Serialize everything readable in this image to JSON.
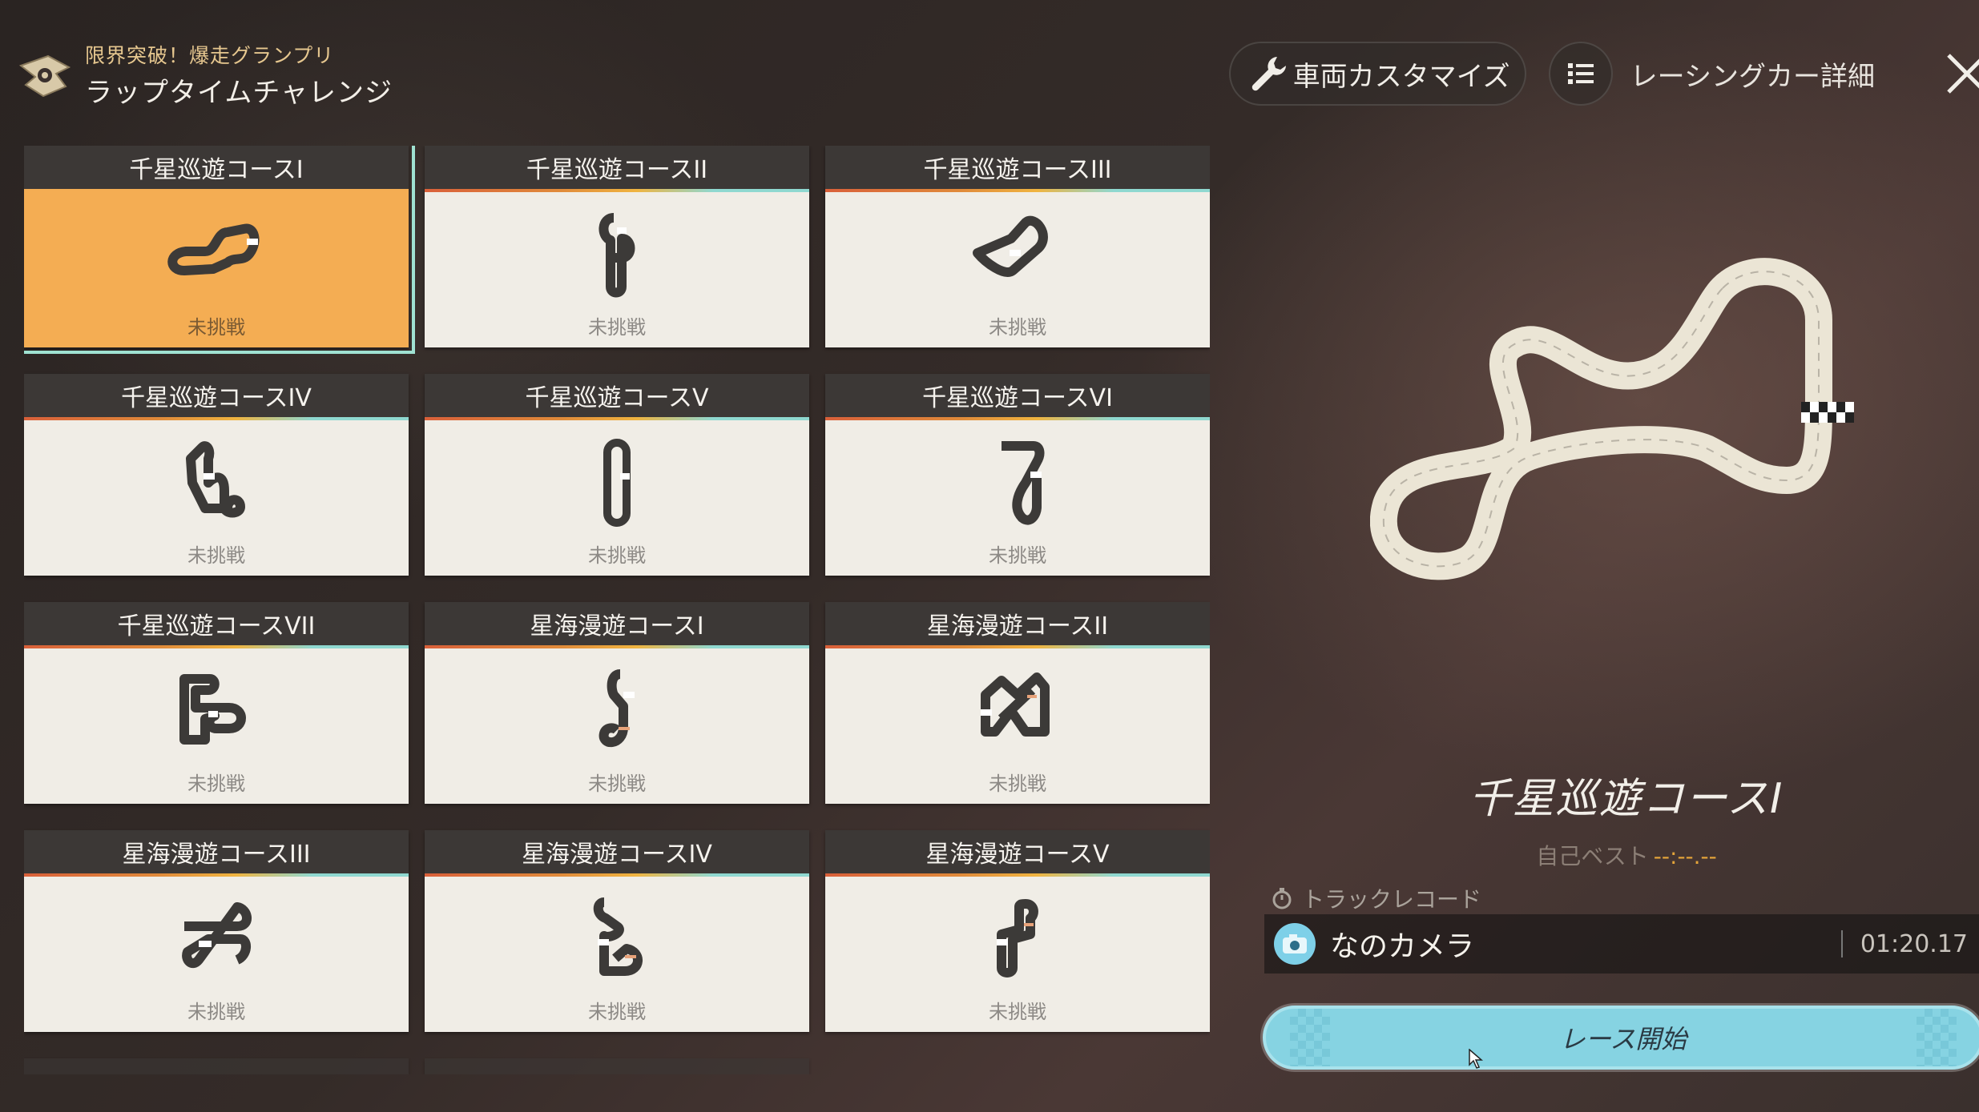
{
  "header": {
    "subtitle": "限界突破！爆走グランプリ",
    "title": "ラップタイムチャレンジ"
  },
  "toolbar": {
    "customize_label": "車両カスタマイズ",
    "customize_icon": "wrench-icon",
    "details_label": "レーシングカー詳細",
    "details_icon": "list-icon",
    "close_icon": "close-icon"
  },
  "courses": [
    {
      "name": "千星巡遊コースI",
      "status": "未挑戦",
      "selected": true
    },
    {
      "name": "千星巡遊コースII",
      "status": "未挑戦"
    },
    {
      "name": "千星巡遊コースIII",
      "status": "未挑戦"
    },
    {
      "name": "千星巡遊コースIV",
      "status": "未挑戦"
    },
    {
      "name": "千星巡遊コースV",
      "status": "未挑戦"
    },
    {
      "name": "千星巡遊コースVI",
      "status": "未挑戦"
    },
    {
      "name": "千星巡遊コースVII",
      "status": "未挑戦"
    },
    {
      "name": "星海漫遊コースI",
      "status": "未挑戦"
    },
    {
      "name": "星海漫遊コースII",
      "status": "未挑戦"
    },
    {
      "name": "星海漫遊コースIII",
      "status": "未挑戦"
    },
    {
      "name": "星海漫遊コースIV",
      "status": "未挑戦"
    },
    {
      "name": "星海漫遊コースV",
      "status": "未挑戦"
    }
  ],
  "detail": {
    "course_name": "千星巡遊コースI",
    "best_label": "自己ベスト",
    "best_value": "--:--.--",
    "record_label": "トラックレコード",
    "record_holder": "なのカメラ",
    "record_time": "01:20.17",
    "start_label": "レース開始"
  },
  "colors": {
    "selected_card": "#f4ad53",
    "selected_outline": "#9fe2d2",
    "start_button": "#86d3e2",
    "best_time": "#e4a43a"
  }
}
